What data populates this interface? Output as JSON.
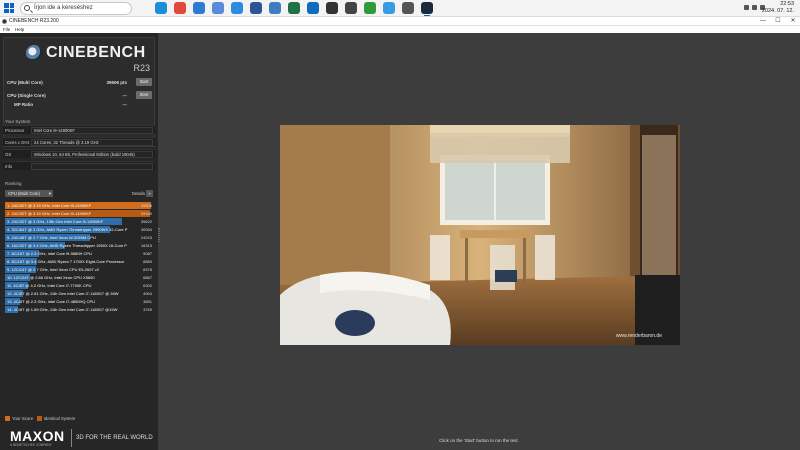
{
  "taskbar": {
    "search_placeholder": "Írjon ide a kereséshez",
    "apps": [
      {
        "name": "edge",
        "color": "#1a8fd8"
      },
      {
        "name": "chrome",
        "color": "#e04a3a"
      },
      {
        "name": "app-3",
        "color": "#2f7ad4"
      },
      {
        "name": "app-4",
        "color": "#5b8ad8"
      },
      {
        "name": "app-5",
        "color": "#2b8de0"
      },
      {
        "name": "word",
        "color": "#2b5797"
      },
      {
        "name": "app-7",
        "color": "#3e7cc4"
      },
      {
        "name": "excel",
        "color": "#1f7244"
      },
      {
        "name": "outlook",
        "color": "#0f6cbd"
      },
      {
        "name": "app-10",
        "color": "#333333"
      },
      {
        "name": "app-11",
        "color": "#444444"
      },
      {
        "name": "app-12",
        "color": "#2e9a3a"
      },
      {
        "name": "app-13",
        "color": "#3a9ce0"
      },
      {
        "name": "app-14",
        "color": "#555555"
      },
      {
        "name": "cinebench",
        "color": "#1b2a3a"
      }
    ],
    "clock_time": "22:53",
    "clock_date": "2024. 07. 12."
  },
  "window": {
    "title": "CINEBENCH R23.200",
    "minimize": "—",
    "maximize": "☐",
    "close": "✕"
  },
  "menu": {
    "file": "File",
    "help": "Help"
  },
  "branding": {
    "name": "CINEBENCH",
    "version": "R23"
  },
  "scores": {
    "multi_label": "CPU (Multi Core)",
    "multi_value": "39506 pts",
    "single_label": "CPU (Single Core)",
    "single_value": "---",
    "mp_label": "MP Ratio",
    "mp_value": "---",
    "start_label": "Start"
  },
  "system": {
    "title": "Your System",
    "rows": [
      {
        "key": "Processor",
        "value": "Intel Core i9-14900KF"
      },
      {
        "key": "Cores x GHz",
        "value": "24 Cores, 32 Threads @ 3.19 GHz"
      },
      {
        "key": "OS",
        "value": "Windows 10, 64 Bit, Professional Edition (build 19045)"
      },
      {
        "key": "Info",
        "value": ""
      }
    ]
  },
  "ranking": {
    "title": "Ranking",
    "selected": "CPU (Multi Core)",
    "details_label": "Details",
    "details_btn": "»",
    "rows": [
      {
        "text": "1. 24C/32T @ 3.19 GHz, Intel Core i9-14900KF",
        "score": "39506",
        "fraction": 1.0,
        "kind": "self"
      },
      {
        "text": "2. 24C/32T @ 3.19 GHz, Intel Core i9-14900KF",
        "score": "39340",
        "fraction": 0.99,
        "kind": "identical"
      },
      {
        "text": "3. 24C/32T @ 3 GHz, 13th Gen Intel Core i9-13900KF",
        "score": "35622",
        "fraction": 0.8,
        "kind": "other"
      },
      {
        "text": "4. 32C/64T @ 3 GHz, AMD Ryzen Threadripper 2990WX 32-Core P",
        "score": "30054",
        "fraction": 0.72,
        "kind": "other"
      },
      {
        "text": "5. 24C/48T @ 2.7 GHz, Intel Xeon W-3265M CPU",
        "score": "24243",
        "fraction": 0.58,
        "kind": "other"
      },
      {
        "text": "6. 16C/32T @ 3.4 GHz, AMD Ryzen Threadripper 1950X 16-Core P",
        "score": "16315",
        "fraction": 0.41,
        "kind": "other"
      },
      {
        "text": "7. 8C/16T @ 2.3 GHz, Intel Core i9-9880H CPU",
        "score": "9087",
        "fraction": 0.23,
        "kind": "other"
      },
      {
        "text": "8. 8C/16T @ 3.4 GHz, AMD Ryzen 7 1700X Eight-Core Processor",
        "score": "8889",
        "fraction": 0.22,
        "kind": "other"
      },
      {
        "text": "9. 12C/24T @ 2.7 GHz, Intel Xeon CPU E5-2697 v2",
        "score": "8378",
        "fraction": 0.21,
        "kind": "other"
      },
      {
        "text": "10. 12C/24T @ 2.66 GHz, Intel Xeon CPU X5650",
        "score": "6867",
        "fraction": 0.17,
        "kind": "other"
      },
      {
        "text": "11. 4C/8T @ 4.2 GHz, Intel Core i7-7700K CPU",
        "score": "6302",
        "fraction": 0.16,
        "kind": "other"
      },
      {
        "text": "12. 4C/8T @ 2.81 GHz, 11th Gen Intel Core i7-1165G7 @ 28W",
        "score": "4904",
        "fraction": 0.12,
        "kind": "other"
      },
      {
        "text": "13. 4C/8T @ 2.3 GHz, Intel Core i7-4850HQ CPU",
        "score": "3891",
        "fraction": 0.1,
        "kind": "other"
      },
      {
        "text": "14. 4C/8T @ 1.69 GHz, 11th Gen Intel Core i7-1165G7 @15W",
        "score": "3769",
        "fraction": 0.09,
        "kind": "other"
      }
    ]
  },
  "legend": {
    "your_score": "Your Score",
    "identical": "Identical System"
  },
  "colors": {
    "self": "#d06c1a",
    "identical": "#b85a12",
    "other": "#2f6da8",
    "accent": "#0a64c8"
  },
  "footer": {
    "brand": "MAXON",
    "sub": "A NEMETSCHEK COMPANY",
    "tagline": "3D FOR THE REAL WORLD"
  },
  "render": {
    "watermark": "www.renderbaron.de"
  },
  "status": "Click on the 'Start' button to run the test."
}
